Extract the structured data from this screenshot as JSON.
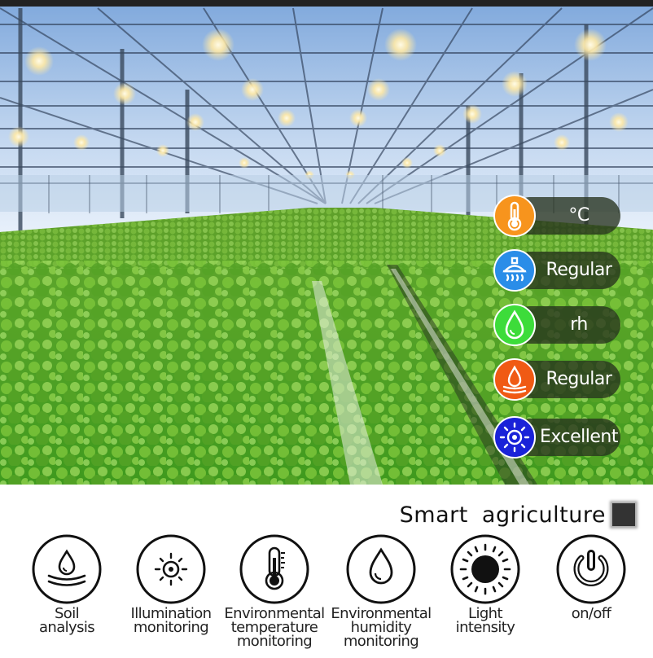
{
  "status_panel": {
    "items": [
      {
        "icon": "thermometer-icon",
        "label": "°C",
        "color": "#f7941d"
      },
      {
        "icon": "sprinkler-icon",
        "label": "Regular",
        "color": "#2a8de8"
      },
      {
        "icon": "water-drop-icon",
        "label": "rh",
        "color": "#3ddc3a"
      },
      {
        "icon": "soil-moisture-icon",
        "label": "Regular",
        "color": "#f05a14"
      },
      {
        "icon": "sun-icon",
        "label": "Excellent",
        "color": "#1a22d8"
      }
    ]
  },
  "brand": {
    "title": "Smart  agriculture"
  },
  "features": [
    {
      "icon": "soil-drop-icon",
      "label": "Soil\nanalysis"
    },
    {
      "icon": "sun-outline-icon",
      "label": "Illumination\nmonitoring"
    },
    {
      "icon": "thermometer-outline-icon",
      "label": "Environmental\ntemperature\nmonitoring"
    },
    {
      "icon": "drop-outline-icon",
      "label": "Environmental\nhumidity\nmonitoring"
    },
    {
      "icon": "light-sun-icon",
      "label": "Light\nintensity"
    },
    {
      "icon": "power-icon",
      "label": "on/off"
    }
  ]
}
